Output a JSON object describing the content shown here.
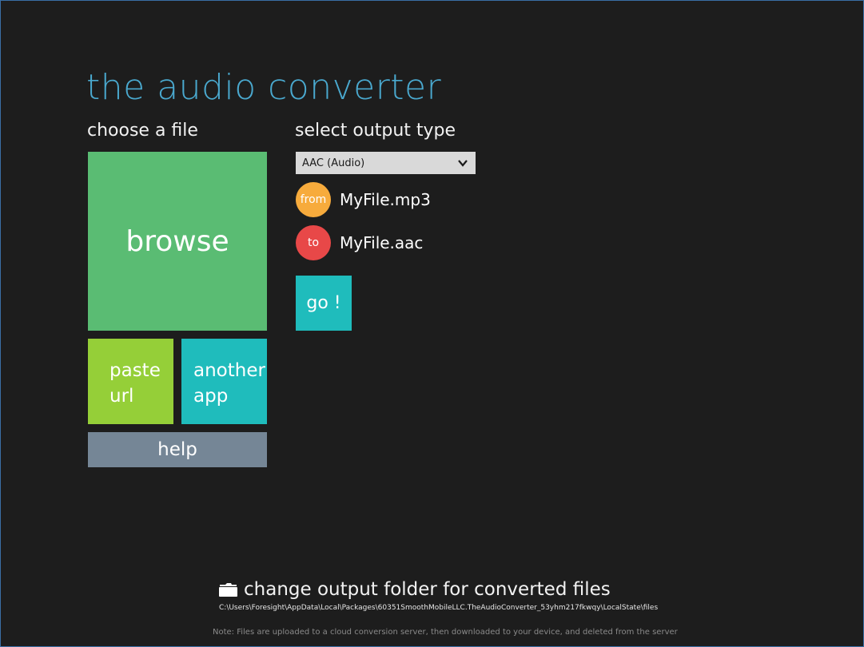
{
  "app": {
    "title": "the audio converter"
  },
  "left": {
    "label": "choose a file",
    "browse_label": "browse",
    "paste_line1": "paste",
    "paste_line2": "url",
    "another_line1": "another",
    "another_line2": "app",
    "help_label": "help"
  },
  "right": {
    "label": "select output type",
    "output_type": {
      "selected": "AAC (Audio)"
    },
    "from_badge": "from",
    "from_file": "MyFile.mp3",
    "to_badge": "to",
    "to_file": "MyFile.aac",
    "go_label": "go !"
  },
  "footer": {
    "folder_label": "change output folder for converted files",
    "folder_path": "C:\\Users\\Foresight\\AppData\\Local\\Packages\\60351SmoothMobileLLC.TheAudioConverter_53yhm217fkwqy\\LocalState\\files",
    "note": "Note: Files are uploaded to a cloud conversion server, then downloaded to your device, and deleted from the server"
  },
  "icons": {
    "dropdown": "chevron-down-icon",
    "folder": "folder-icon"
  },
  "colors": {
    "background": "#1d1d1d",
    "title": "#4aa9cf",
    "browse_tile": "#5abc73",
    "paste_tile": "#95cf38",
    "another_tile": "#1fbcbc",
    "help_tile": "#758696",
    "go_tile": "#1fbcbc",
    "from_badge": "#f7ab3c",
    "to_badge": "#e84848"
  }
}
